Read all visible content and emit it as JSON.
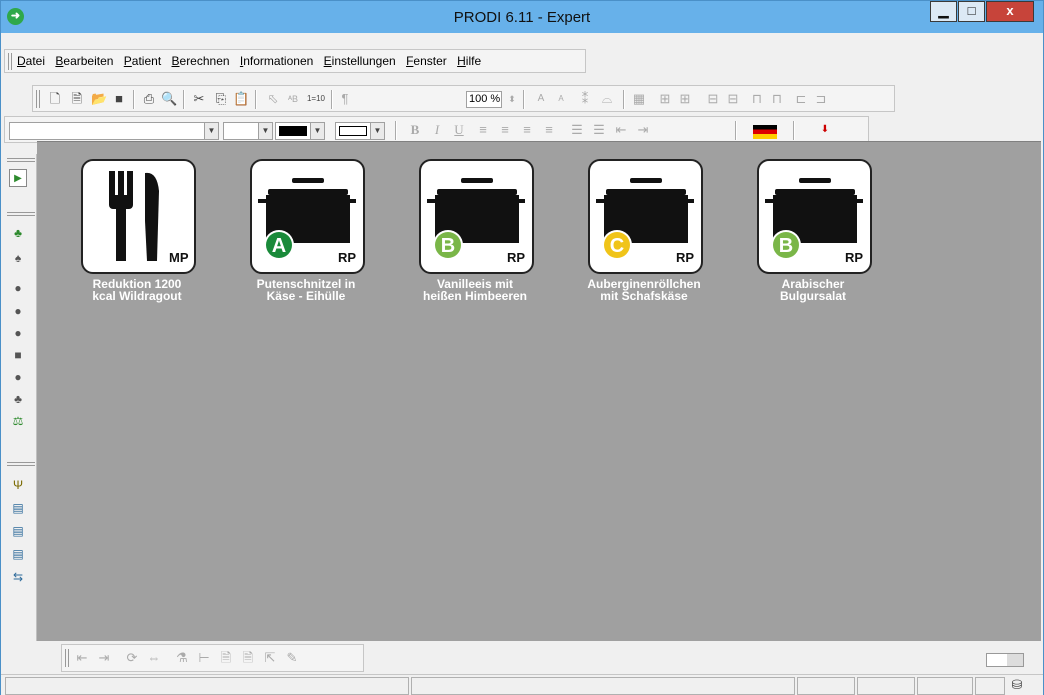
{
  "window": {
    "title": "PRODI 6.11 - Expert",
    "min_label": "▁",
    "max_label": "□",
    "close_label": "x"
  },
  "menu": [
    "Datei",
    "Bearbeiten",
    "Patient",
    "Berechnen",
    "Informationen",
    "Einstellungen",
    "Fenster",
    "Hilfe"
  ],
  "toolbar": {
    "zoom": "100 %",
    "number_format": "1=10"
  },
  "recipes": [
    {
      "badge_text": "MP",
      "grade": "",
      "grade_color": "",
      "label_line1": "Reduktion 1200",
      "label_line2": "kcal Wildragout",
      "icon": "cutlery-icon"
    },
    {
      "badge_text": "RP",
      "grade": "A",
      "grade_color": "#1a8a3a",
      "label_line1": "Putenschnitzel in",
      "label_line2": "Käse - Eihülle",
      "icon": "pot-icon"
    },
    {
      "badge_text": "RP",
      "grade": "B",
      "grade_color": "#7ab648",
      "label_line1": "Vanilleeis mit",
      "label_line2": "heißen Himbeeren",
      "icon": "pot-icon"
    },
    {
      "badge_text": "RP",
      "grade": "C",
      "grade_color": "#f0c419",
      "label_line1": "Auberginenröllchen",
      "label_line2": "mit Schafskäse",
      "icon": "pot-icon"
    },
    {
      "badge_text": "RP",
      "grade": "B",
      "grade_color": "#7ab648",
      "label_line1": "Arabischer",
      "label_line2": "Bulgursalat",
      "icon": "pot-icon"
    }
  ],
  "colors": {
    "titlebar": "#67b1ea",
    "workspace": "#a0a0a0"
  }
}
